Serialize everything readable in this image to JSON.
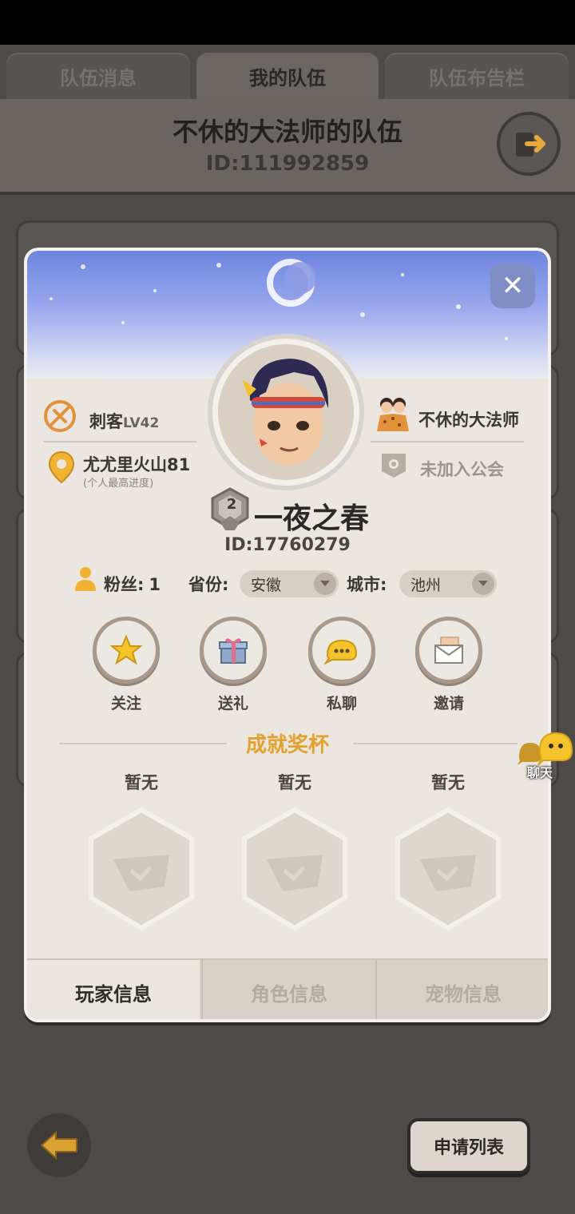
{
  "tabs": [
    {
      "label": "队伍消息",
      "active": false
    },
    {
      "label": "我的队伍",
      "active": true
    },
    {
      "label": "队伍布告栏",
      "active": false
    }
  ],
  "team": {
    "title": "不休的大法师的队伍",
    "id": "ID:111992859"
  },
  "profile": {
    "class_label": "刺客",
    "level": "LV42",
    "progress_stage": "尤尤里火山81",
    "progress_note": "(个人最高进度)",
    "captain_name": "不休的大法师",
    "guild_status": "未加入公会",
    "rank_badge": "2",
    "nickname": "一夜之春",
    "player_id": "ID:17760279",
    "fans_label": "粉丝:",
    "fans_count": "1",
    "province_label": "省份:",
    "province_value": "安徽",
    "city_label": "城市:",
    "city_value": "池州"
  },
  "actions": [
    {
      "label": "关注",
      "icon": "star-icon"
    },
    {
      "label": "送礼",
      "icon": "gift-icon"
    },
    {
      "label": "私聊",
      "icon": "chat-icon"
    },
    {
      "label": "邀请",
      "icon": "mail-icon"
    }
  ],
  "achievements": {
    "title": "成就奖杯",
    "slots": [
      {
        "label": "暂无"
      },
      {
        "label": "暂无"
      },
      {
        "label": "暂无"
      }
    ]
  },
  "bottom_tabs": [
    {
      "label": "玩家信息",
      "active": true
    },
    {
      "label": "角色信息",
      "active": false
    },
    {
      "label": "宠物信息",
      "active": false
    }
  ],
  "chat_float": {
    "label": "聊天"
  },
  "footer": {
    "apply_list": "申请列表"
  },
  "colors": {
    "accent_gold": "#e2a22d",
    "panel": "#ebe6df",
    "background": "#4d4a47"
  }
}
